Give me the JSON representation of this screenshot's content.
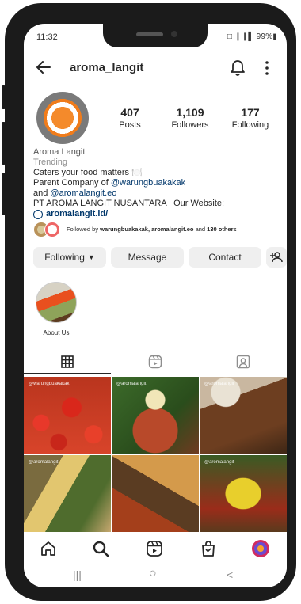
{
  "status_bar": {
    "time": "11:32",
    "right": "□ ❙❙▌ 99%▮"
  },
  "profile": {
    "username": "aroma_langit",
    "stats": [
      {
        "value": "407",
        "label": "Posts"
      },
      {
        "value": "1,109",
        "label": "Followers"
      },
      {
        "value": "177",
        "label": "Following"
      }
    ],
    "display_name": "Aroma Langit",
    "category": "Trending",
    "bio_line1": "Caters your food matters 🍽️",
    "bio_line2_prefix": "Parent Company of ",
    "bio_line2_mention": "@warungbuakakak",
    "bio_line3_prefix": "and ",
    "bio_line3_mention": "@aromalangit.eo",
    "bio_line4": "PT AROMA LANGIT NUSANTARA | Our Website:",
    "link": "aromalangit.id/",
    "followed_by_prefix": "Followed by ",
    "followed_by_names": "warungbuakakak, aromalangit.eo",
    "followed_by_suffix": " and ",
    "followed_by_count": "130 others"
  },
  "actions": {
    "following_label": "Following",
    "message_label": "Message",
    "contact_label": "Contact"
  },
  "highlights": [
    {
      "label": "About Us"
    }
  ],
  "grid": {
    "watermarks": [
      "@warungbuakakak",
      "@aromalangit",
      "@aromalangit",
      "@aromalangit",
      "",
      "@aromalangit"
    ]
  },
  "icons": {
    "back": "back-arrow-icon",
    "bell": "bell-icon",
    "more": "more-vertical-icon",
    "grid_tab": "grid-icon",
    "reels_tab": "reels-icon",
    "tagged_tab": "tagged-icon",
    "home": "home-icon",
    "search": "search-icon",
    "reels": "reels-icon",
    "shop": "shop-icon"
  },
  "system_nav": {
    "recents": "|||",
    "home": "○",
    "back": "<"
  }
}
